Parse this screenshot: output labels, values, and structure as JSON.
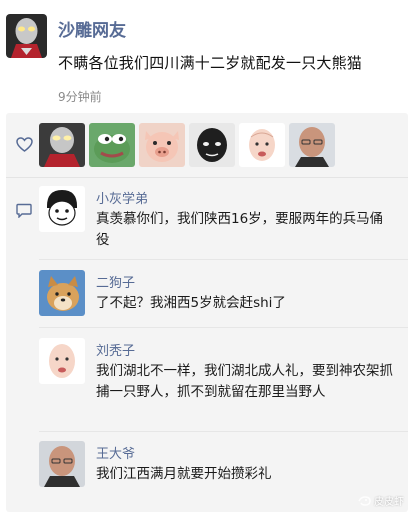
{
  "post": {
    "author": "沙雕网友",
    "text": "不瞒各位我们四川满十二岁就配发一只大熊猫",
    "time": "9分钟前"
  },
  "likes": {
    "avatars": [
      "ultraman-avatar",
      "pepe-frog-avatar",
      "pig-avatar",
      "dark-face-avatar",
      "bald-cartoon-avatar",
      "old-man-avatar"
    ]
  },
  "comments": [
    {
      "name": "小灰学弟",
      "text": "真羡慕你们，我们陕西16岁，要服两年的兵马俑役",
      "avatar": "cartoon-boy-avatar"
    },
    {
      "name": "二狗子",
      "text": "了不起？我湘西5岁就会赶shi了",
      "avatar": "shiba-dog-avatar"
    },
    {
      "name": "刘秃子",
      "text": "我们湖北不一样，我们湖北成人礼，要到神农架抓捕一只野人，抓不到就留在那里当野人",
      "avatar": "bald-cartoon-avatar"
    },
    {
      "name": "王大爷",
      "text": "我们江西满月就要开始攒彩礼",
      "avatar": "old-man-avatar"
    }
  ],
  "watermark": {
    "text": "皮皮虾"
  },
  "colors": {
    "link_blue": "#576b95",
    "panel_bg": "#f4f4f4",
    "time_gray": "#8a8a8a"
  }
}
